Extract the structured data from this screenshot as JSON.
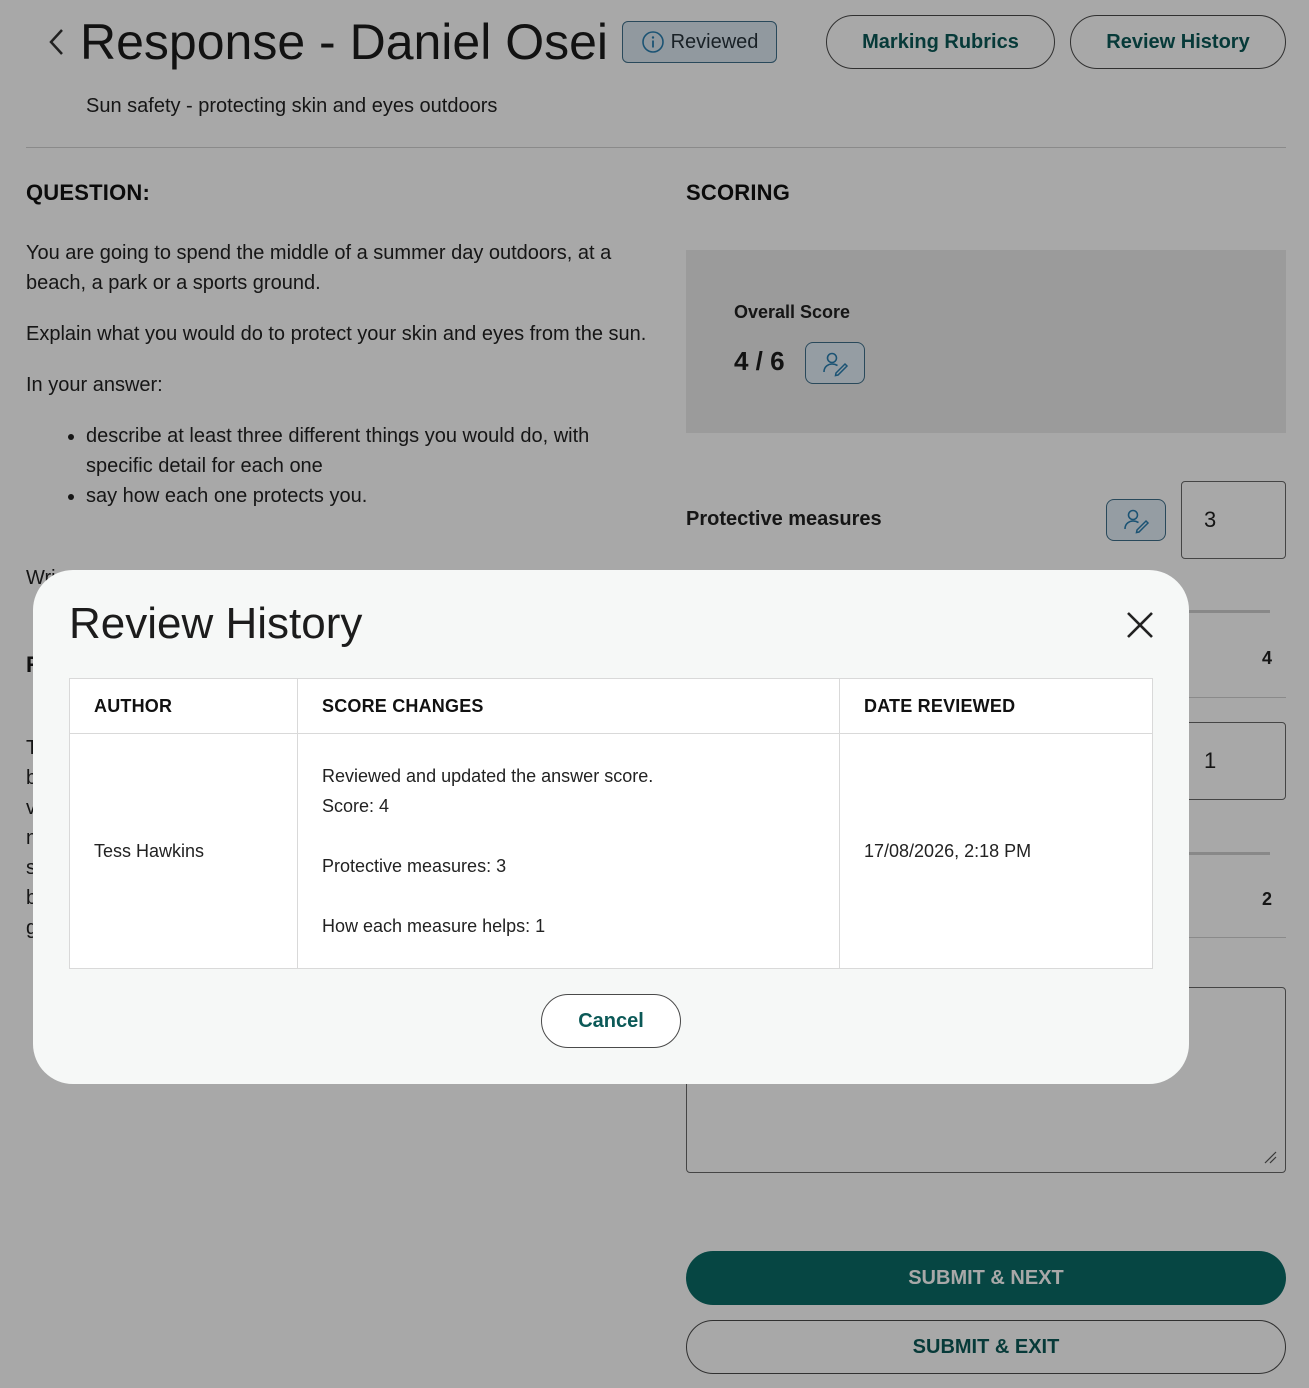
{
  "header": {
    "back_icon": "chevron-left-icon",
    "title": "Response - Daniel Osei",
    "status_badge": "Reviewed",
    "status_icon": "info-icon",
    "marking_rubrics_label": "Marking Rubrics",
    "review_history_label": "Review History",
    "subtitle": "Sun safety - protecting skin and eyes outdoors"
  },
  "question": {
    "heading": "QUESTION:",
    "paragraphs": [
      "You are going to spend the middle of a summer day outdoors, at a beach, a park or a sports ground.",
      "Explain what you would do to protect your skin and eyes from the sun.",
      "In your answer:"
    ],
    "bullets": [
      "describe at least three different things you would do, with specific detail for each one",
      "say how each one protects you."
    ],
    "partial_line": "Wri",
    "partial_heading": "R",
    "partial_column_letters": [
      "T",
      "b",
      "v",
      "n",
      "s",
      "b",
      "g"
    ]
  },
  "scoring": {
    "heading": "SCORING",
    "overall_label": "Overall Score",
    "overall_value": "4 / 6",
    "criteria": [
      {
        "label": "Protective measures",
        "score": "3",
        "max": "4"
      },
      {
        "score": "1",
        "max": "2"
      }
    ],
    "override_icon": "user-edit-icon",
    "submit_next_label": "SUBMIT & NEXT",
    "submit_exit_label": "SUBMIT & EXIT"
  },
  "modal": {
    "title": "Review History",
    "close_icon": "close-icon",
    "columns": [
      "AUTHOR",
      "SCORE CHANGES",
      "DATE REVIEWED"
    ],
    "rows": [
      {
        "author": "Tess Hawkins",
        "changes_summary": "Reviewed and updated the answer score.",
        "changes_score": "Score: 4",
        "changes_criterion_1": "Protective measures: 3",
        "changes_criterion_2": "How each measure helps: 1",
        "date": "17/08/2026, 2:18 PM"
      }
    ],
    "cancel_label": "Cancel"
  },
  "colors": {
    "brand_teal": "#0a6b66",
    "brand_teal_text": "#0b5957",
    "badge_bg": "#dde9f2",
    "badge_border": "#3f6f8a",
    "overlay": "rgba(0,0,0,0.34)"
  }
}
